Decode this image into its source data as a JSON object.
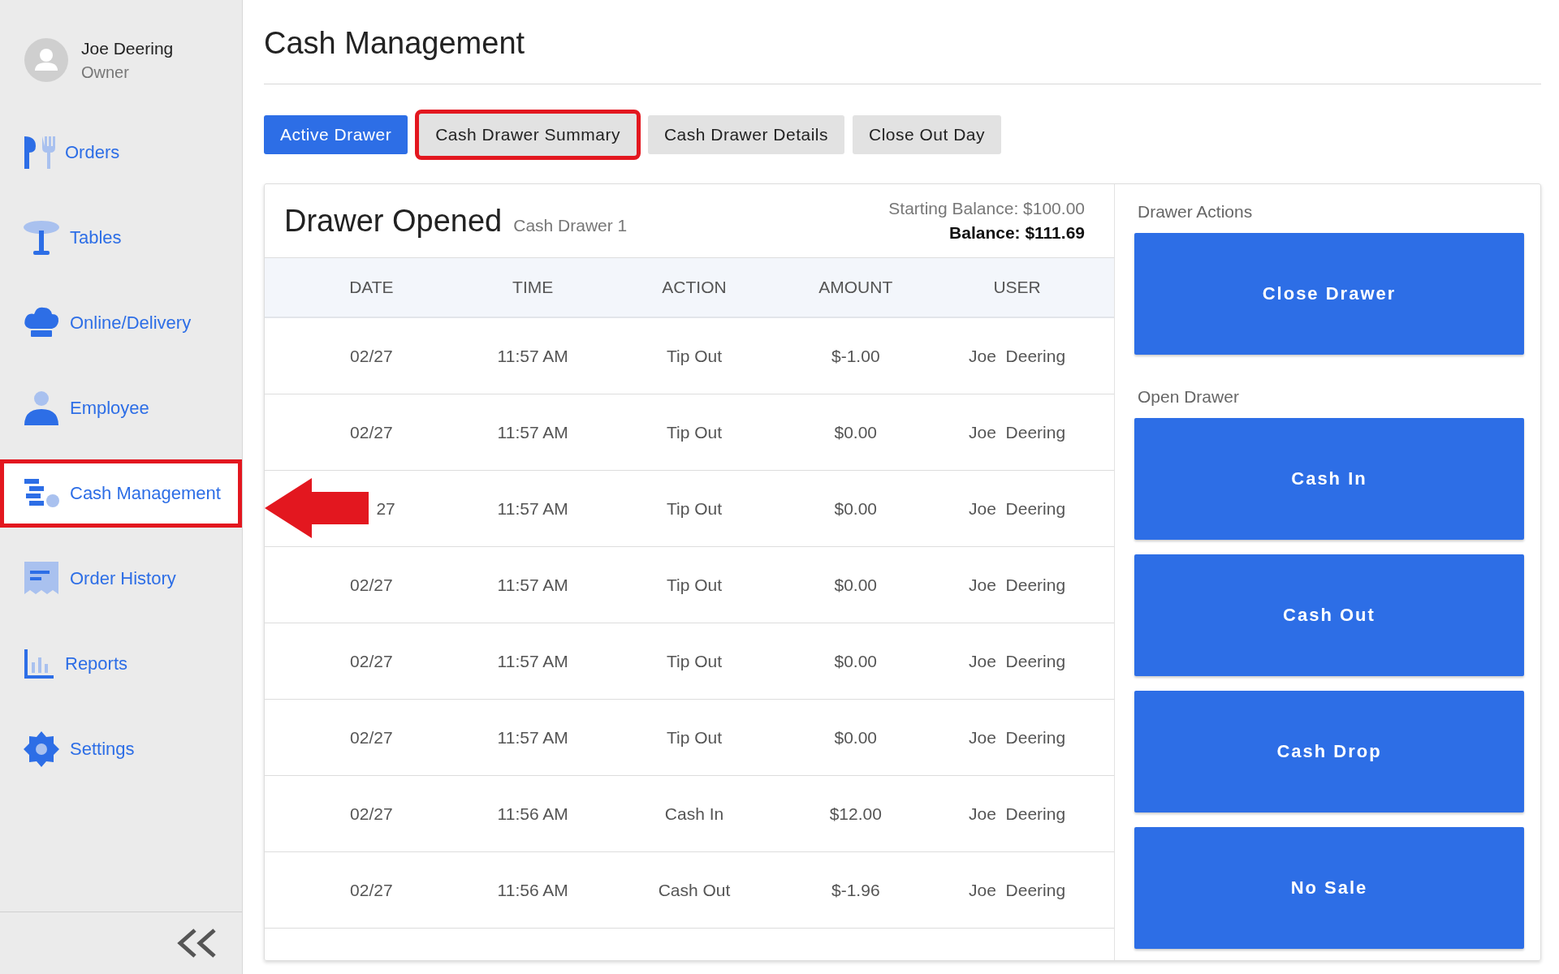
{
  "user": {
    "name": "Joe Deering",
    "role": "Owner"
  },
  "sidebar": {
    "items": [
      {
        "label": "Orders",
        "kind": "orders",
        "selected": false,
        "highlighted": false
      },
      {
        "label": "Tables",
        "kind": "tables",
        "selected": false,
        "highlighted": false
      },
      {
        "label": "Online/Delivery",
        "kind": "delivery",
        "selected": false,
        "highlighted": false
      },
      {
        "label": "Employee",
        "kind": "employee",
        "selected": false,
        "highlighted": false
      },
      {
        "label": "Cash Management",
        "kind": "cash",
        "selected": true,
        "highlighted": true
      },
      {
        "label": "Order History",
        "kind": "history",
        "selected": false,
        "highlighted": false
      },
      {
        "label": "Reports",
        "kind": "reports",
        "selected": false,
        "highlighted": false
      },
      {
        "label": "Settings",
        "kind": "settings",
        "selected": false,
        "highlighted": false
      }
    ]
  },
  "page_title": "Cash Management",
  "tabs": [
    {
      "label": "Active Drawer",
      "selected": true,
      "highlighted": false
    },
    {
      "label": "Cash Drawer Summary",
      "selected": false,
      "highlighted": true
    },
    {
      "label": "Cash Drawer Details",
      "selected": false,
      "highlighted": false
    },
    {
      "label": "Close Out Day",
      "selected": false,
      "highlighted": false
    }
  ],
  "drawer": {
    "title": "Drawer Opened",
    "name": "Cash Drawer 1",
    "starting_balance": "Starting Balance: $100.00",
    "balance": "Balance: $111.69"
  },
  "table": {
    "columns": [
      "DATE",
      "TIME",
      "ACTION",
      "AMOUNT",
      "USER"
    ],
    "rows": [
      {
        "cells": [
          "02/27",
          "11:57 AM",
          "Tip Out",
          "$-1.00",
          "Joe  Deering"
        ],
        "arrow": false
      },
      {
        "cells": [
          "02/27",
          "11:57 AM",
          "Tip Out",
          "$0.00",
          "Joe  Deering"
        ],
        "arrow": false
      },
      {
        "cells": [
          "27",
          "11:57 AM",
          "Tip Out",
          "$0.00",
          "Joe  Deering"
        ],
        "arrow": true
      },
      {
        "cells": [
          "02/27",
          "11:57 AM",
          "Tip Out",
          "$0.00",
          "Joe  Deering"
        ],
        "arrow": false
      },
      {
        "cells": [
          "02/27",
          "11:57 AM",
          "Tip Out",
          "$0.00",
          "Joe  Deering"
        ],
        "arrow": false
      },
      {
        "cells": [
          "02/27",
          "11:57 AM",
          "Tip Out",
          "$0.00",
          "Joe  Deering"
        ],
        "arrow": false
      },
      {
        "cells": [
          "02/27",
          "11:56 AM",
          "Cash In",
          "$12.00",
          "Joe  Deering"
        ],
        "arrow": false
      },
      {
        "cells": [
          "02/27",
          "11:56 AM",
          "Cash Out",
          "$-1.96",
          "Joe  Deering"
        ],
        "arrow": false
      }
    ]
  },
  "actions": {
    "sections": [
      {
        "heading": "Drawer Actions",
        "buttons": [
          "Close Drawer"
        ]
      },
      {
        "heading": "Open Drawer",
        "buttons": [
          "Cash In",
          "Cash Out",
          "Cash Drop",
          "No Sale"
        ]
      }
    ]
  }
}
